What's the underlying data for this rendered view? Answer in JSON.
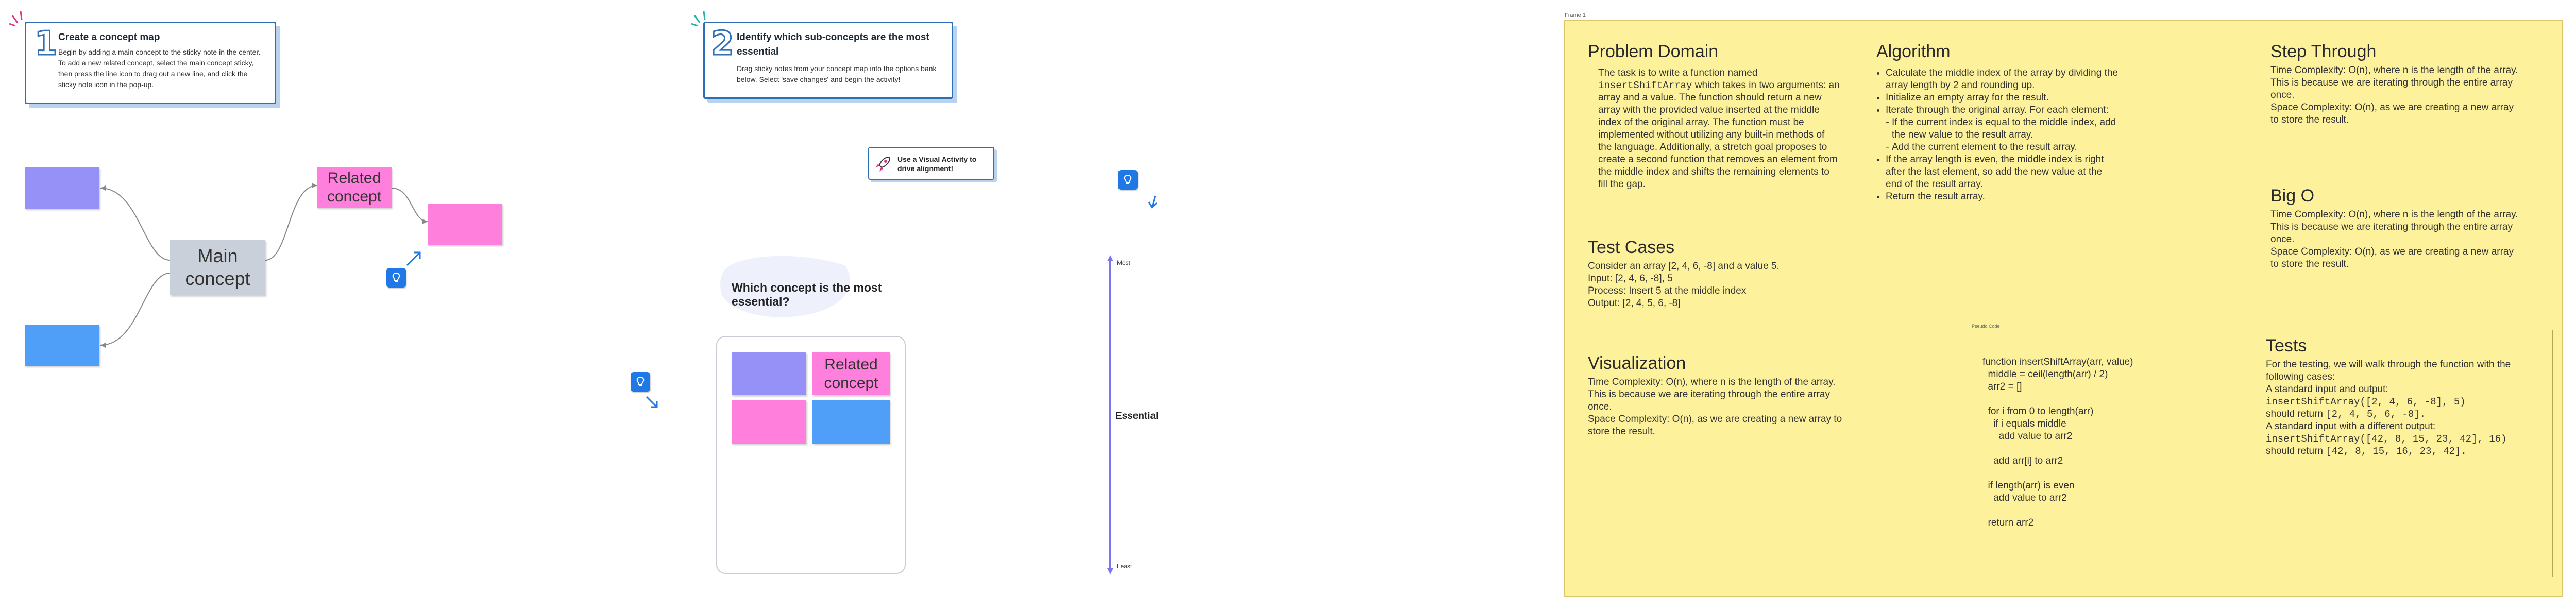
{
  "step1": {
    "number": "1",
    "title": "Create a concept map",
    "text": "Begin by adding a main concept to the sticky note in the center. To add a new related concept, select the main concept sticky, then press the line icon to drag out a new line, and click the sticky note icon in the pop-up."
  },
  "step2": {
    "number": "2",
    "title": "Identify which sub-concepts are the most essential",
    "text": "Drag sticky notes from your concept map into the options bank below. Select 'save changes' and begin the activity!"
  },
  "concept_map": {
    "main": "Main concept",
    "related": "Related concept"
  },
  "visual_activity": {
    "label": "Use a Visual Activity to drive alignment!"
  },
  "question": "Which concept is the most essential?",
  "options_bank": {
    "related": "Related concept"
  },
  "scale": {
    "top": "Most",
    "middle": "Essential",
    "bottom": "Least"
  },
  "frame": {
    "label": "Frame 1",
    "problem_domain": {
      "heading": "Problem Domain",
      "p1": "The task is to write a function named",
      "code": "insertShiftArray",
      "p2": "which takes in two arguments: an array and a value. The function should return a new array with the provided value inserted at the middle index of the original array. The function must be implemented without utilizing any built-in methods of the language. Additionally, a stretch goal proposes to create a second function that removes an element from the middle index and shifts the remaining elements to fill the gap."
    },
    "algorithm": {
      "heading": "Algorithm",
      "i1": "Calculate the middle index of the array by dividing the array length by 2 and rounding up.",
      "i2": "Initialize an empty array for the result.",
      "i3": "Iterate through the original array. For each element:",
      "s1": "If the current index is equal to the middle index, add the new value to the result array.",
      "s2": "Add the current element to the result array.",
      "i4": "If the array length is even, the middle index is right after the last element, so add the new value at the end of the result array.",
      "i5": "Return the result array."
    },
    "step_through": {
      "heading": "Step Through",
      "text": "Time Complexity: O(n), where n is the length of the array. This is because we are iterating through the entire array once.\nSpace Complexity: O(n), as we are creating a new array to store the result."
    },
    "big_o": {
      "heading": "Big O",
      "text": "Time Complexity: O(n), where n is the length of the array. This is because we are iterating through the entire array once.\nSpace Complexity: O(n), as we are creating a new array to store the result."
    },
    "test_cases": {
      "heading": "Test Cases",
      "text": "Consider an array [2, 4, 6, -8] and a value 5.\nInput: [2, 4, 6, -8], 5\nProcess: Insert 5 at the middle index\nOutput: [2, 4, 5, 6, -8]"
    },
    "visualization": {
      "heading": "Visualization",
      "text": "Time Complexity: O(n), where n is the length of the array. This is because we are iterating through the entire array once.\nSpace Complexity: O(n), as we are creating a new array to store the result."
    },
    "pseudo_label": "Pseudo Code",
    "pseudo": "function insertShiftArray(arr, value)\n  middle = ceil(length(arr) / 2)\n  arr2 = []\n\n  for i from 0 to length(arr)\n    if i equals middle\n      add value to arr2\n\n    add arr[i] to arr2\n\n  if length(arr) is even\n    add value to arr2\n\n  return arr2",
    "tests": {
      "heading": "Tests",
      "l1": "For the testing, we will walk through the function with the following cases:",
      "l2": "A standard input and output:",
      "c1": "insertShiftArray([2, 4, 6, -8], 5)",
      "l3a": "should return",
      "c2": "[2, 4, 5, 6, -8].",
      "l4": "A standard input with a different output:",
      "c3": "insertShiftArray([42, 8, 15, 23, 42], 16)",
      "l5a": "should return",
      "c4": "[42, 8, 15, 16, 23, 42]."
    }
  },
  "colors": {
    "accent": "#2f6fb8",
    "frame": "#fdf29b",
    "pink": "#ff7fdc",
    "purple": "#9691f7",
    "blue": "#4f9ef7"
  }
}
